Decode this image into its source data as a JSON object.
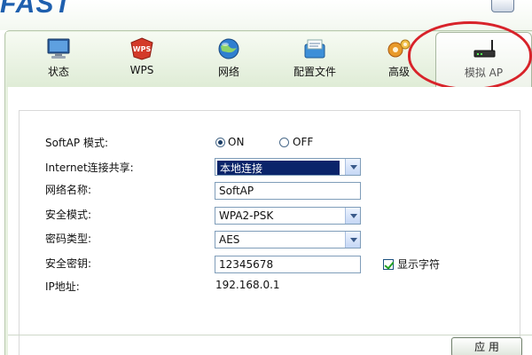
{
  "app": {
    "brand": "FAST"
  },
  "toolbar": {
    "tabs": [
      {
        "label": "状态",
        "icon": "monitor-icon"
      },
      {
        "label": "WPS",
        "icon": "wps-badge-icon"
      },
      {
        "label": "网络",
        "icon": "network-globe-icon"
      },
      {
        "label": "配置文件",
        "icon": "profile-folder-icon"
      },
      {
        "label": "高级",
        "icon": "gears-icon"
      },
      {
        "label": "模拟 AP",
        "icon": "router-icon",
        "active": true
      }
    ]
  },
  "form": {
    "softap_mode": {
      "label": "SoftAP 模式:",
      "on_label": "ON",
      "off_label": "OFF",
      "selected": "ON"
    },
    "internet_sharing": {
      "label": "Internet连接共享:",
      "value": "本地连接"
    },
    "network_name": {
      "label": "网络名称:",
      "value": "SoftAP"
    },
    "security_mode": {
      "label": "安全模式:",
      "value": "WPA2-PSK"
    },
    "cipher_type": {
      "label": "密码类型:",
      "value": "AES"
    },
    "security_key": {
      "label": "安全密钥:",
      "value": "12345678",
      "show_chars_label": "显示字符",
      "show_chars_checked": true
    },
    "ip_address": {
      "label": "IP地址:",
      "value": "192.168.0.1"
    }
  },
  "actions": {
    "apply_label": "应 用"
  },
  "colors": {
    "brand": "#1e5fae",
    "highlight_ring": "#d8232a",
    "selection": "#0a246a",
    "frame": "#e7f1e0"
  }
}
